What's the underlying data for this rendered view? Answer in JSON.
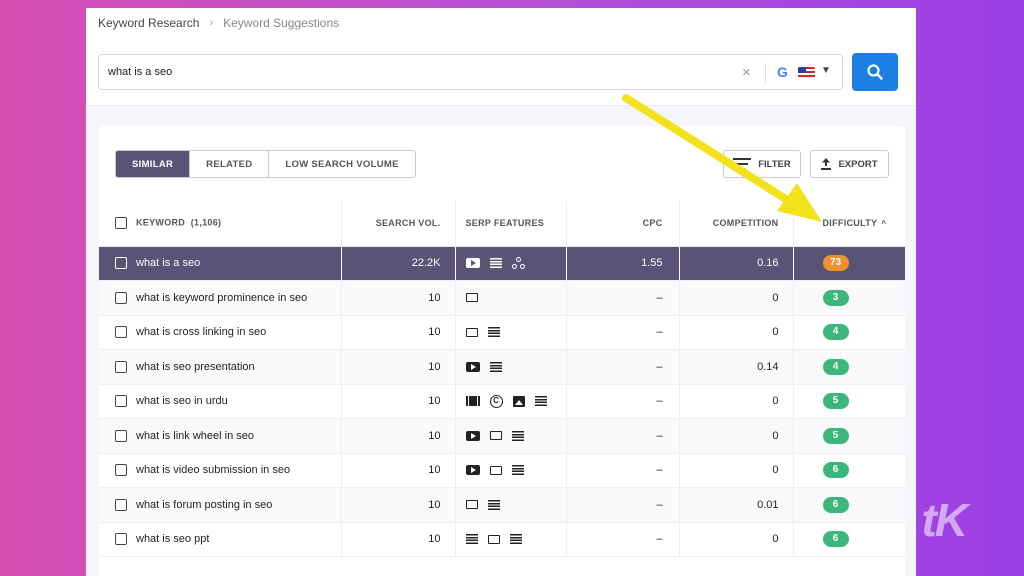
{
  "breadcrumb": {
    "parent": "Keyword Research",
    "current": "Keyword Suggestions"
  },
  "search": {
    "value": "what is a seo",
    "engine_icon": "google-icon",
    "country_icon": "us-flag-icon"
  },
  "tabs": [
    {
      "label": "SIMILAR",
      "active": true
    },
    {
      "label": "RELATED",
      "active": false
    },
    {
      "label": "LOW SEARCH VOLUME",
      "active": false
    }
  ],
  "actions": {
    "filter_label": "FILTER",
    "export_label": "EXPORT"
  },
  "table": {
    "columns": {
      "keyword": "KEYWORD",
      "keyword_count": "(1,106)",
      "volume": "SEARCH VOL.",
      "serp": "SERP FEATURES",
      "cpc": "CPC",
      "competition": "COMPETITION",
      "difficulty": "DIFFICULTY"
    },
    "rows": [
      {
        "keyword": "what is a seo",
        "volume": "22.2K",
        "serp": [
          "video-icon",
          "list-icon",
          "network-icon"
        ],
        "cpc": "1.55",
        "competition": "0.16",
        "difficulty": "73",
        "level": "orange",
        "selected": true
      },
      {
        "keyword": "what is keyword prominence in seo",
        "volume": "10",
        "serp": [
          "snippet-icon"
        ],
        "cpc": "–",
        "competition": "0",
        "difficulty": "3",
        "level": "green",
        "selected": false
      },
      {
        "keyword": "what is cross linking in seo",
        "volume": "10",
        "serp": [
          "snippet-icon",
          "list-icon"
        ],
        "cpc": "–",
        "competition": "0",
        "difficulty": "4",
        "level": "green",
        "selected": false
      },
      {
        "keyword": "what is seo presentation",
        "volume": "10",
        "serp": [
          "video-icon",
          "list-icon"
        ],
        "cpc": "–",
        "competition": "0.14",
        "difficulty": "4",
        "level": "green",
        "selected": false
      },
      {
        "keyword": "what is seo in urdu",
        "volume": "10",
        "serp": [
          "carousel-icon",
          "copyright-icon",
          "image-icon",
          "list-icon"
        ],
        "cpc": "–",
        "competition": "0",
        "difficulty": "5",
        "level": "green",
        "selected": false
      },
      {
        "keyword": "what is link wheel in seo",
        "volume": "10",
        "serp": [
          "video-icon",
          "snippet-icon",
          "list-icon"
        ],
        "cpc": "–",
        "competition": "0",
        "difficulty": "5",
        "level": "green",
        "selected": false
      },
      {
        "keyword": "what is video submission in seo",
        "volume": "10",
        "serp": [
          "video-icon",
          "snippet-icon",
          "list-icon"
        ],
        "cpc": "–",
        "competition": "0",
        "difficulty": "6",
        "level": "green",
        "selected": false
      },
      {
        "keyword": "what is forum posting in seo",
        "volume": "10",
        "serp": [
          "snippet-icon",
          "list-icon"
        ],
        "cpc": "–",
        "competition": "0.01",
        "difficulty": "6",
        "level": "green",
        "selected": false
      },
      {
        "keyword": "what is seo ppt",
        "volume": "10",
        "serp": [
          "list-icon",
          "snippet-icon",
          "list-icon"
        ],
        "cpc": "–",
        "competition": "0",
        "difficulty": "6",
        "level": "green",
        "selected": false
      }
    ]
  },
  "colors": {
    "accent": "#1d7ee3",
    "selected_row": "#585476",
    "badge_green": "#3cb67a",
    "badge_orange": "#f0922b",
    "arrow": "#f2e21b"
  }
}
